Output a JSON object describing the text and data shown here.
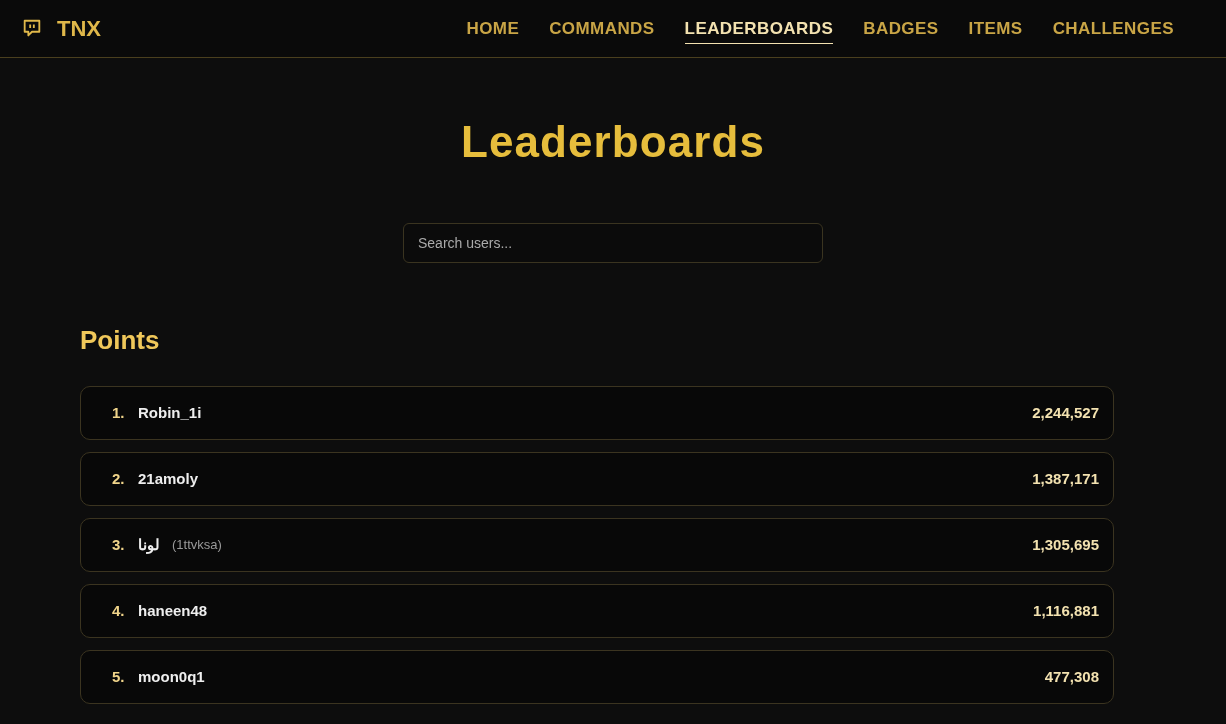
{
  "brand": {
    "name": "TNX"
  },
  "nav": [
    {
      "label": "HOME",
      "selected": false
    },
    {
      "label": "COMMANDS",
      "selected": false
    },
    {
      "label": "LEADERBOARDS",
      "selected": true
    },
    {
      "label": "BADGES",
      "selected": false
    },
    {
      "label": "ITEMS",
      "selected": false
    },
    {
      "label": "CHALLENGES",
      "selected": false
    }
  ],
  "title": "Leaderboards",
  "search": {
    "placeholder": "Search users..."
  },
  "section": {
    "title": "Points",
    "rows": [
      {
        "rank": "1.",
        "name": "Robin_1i",
        "points": "2,244,527"
      },
      {
        "rank": "2.",
        "name": "21amoly",
        "points": "1,387,171"
      },
      {
        "rank": "3.",
        "name": "لونا",
        "login": "(1ttvksa)",
        "points": "1,305,695"
      },
      {
        "rank": "4.",
        "name": "haneen48",
        "points": "1,116,881"
      },
      {
        "rank": "5.",
        "name": "moon0q1",
        "points": "477,308"
      }
    ]
  }
}
